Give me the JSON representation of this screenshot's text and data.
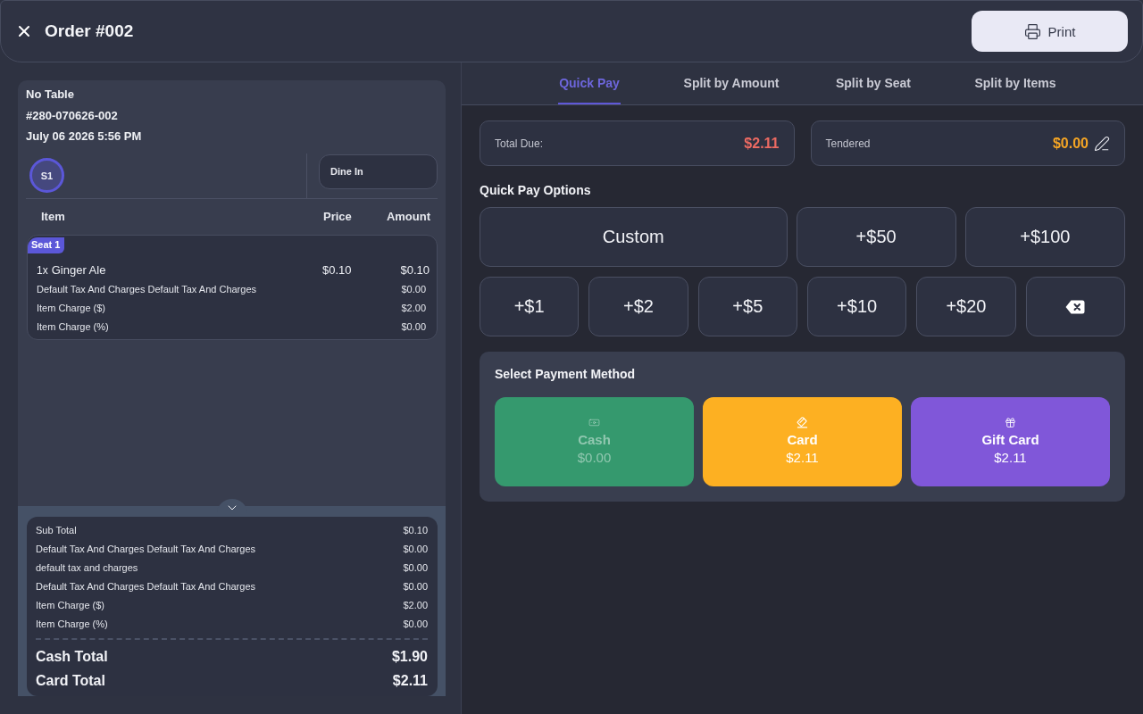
{
  "header": {
    "title": "Order #002",
    "print_label": "Print"
  },
  "order": {
    "table": "No Table",
    "number": "#280-070626-002",
    "datetime": "July 06 2026 5:56 PM",
    "seats": [
      {
        "label": "S1",
        "selected": true
      }
    ],
    "order_type": "Dine In",
    "columns": [
      "Item",
      "Price",
      "Amount"
    ],
    "seat_groups": [
      {
        "badge": "Seat 1",
        "items": [
          {
            "quantity": "1x",
            "name": "Ginger Ale",
            "price": "$0.10",
            "amount": "$0.10",
            "charges": [
              {
                "label": "Default Tax And Charges Default Tax And Charges",
                "amount": "$0.00"
              },
              {
                "label": "Item Charge ($)",
                "amount": "$2.00"
              },
              {
                "label": "Item Charge (%)",
                "amount": "$0.00"
              }
            ]
          }
        ]
      }
    ]
  },
  "summary": {
    "expanded": true,
    "rows": [
      {
        "label": "Sub Total",
        "amount": "$0.10"
      },
      {
        "label": "Default Tax And Charges Default Tax And Charges",
        "amount": "$0.00"
      },
      {
        "label": "default tax and charges",
        "amount": "$0.00"
      },
      {
        "label": "Default Tax And Charges Default Tax And Charges",
        "amount": "$0.00"
      },
      {
        "label": "Item Charge ($)",
        "amount": "$2.00"
      },
      {
        "label": "Item Charge (%)",
        "amount": "$0.00"
      }
    ],
    "totals": [
      {
        "label": "Cash Total",
        "amount": "$1.90"
      },
      {
        "label": "Card Total",
        "amount": "$2.11"
      }
    ]
  },
  "tabs": [
    {
      "label": "Quick Pay",
      "selected": true
    },
    {
      "label": "Split by Amount",
      "selected": false
    },
    {
      "label": "Split by Seat",
      "selected": false
    },
    {
      "label": "Split by Items",
      "selected": false
    }
  ],
  "due": {
    "label": "Total Due:",
    "amount": "$2.11"
  },
  "tendered": {
    "label": "Tendered",
    "amount": "$0.00"
  },
  "quick_pay": {
    "title": "Quick Pay Options",
    "presets": [
      {
        "kind": "custom",
        "label": "Custom"
      },
      {
        "kind": "amount",
        "label": "+$50"
      },
      {
        "kind": "amount",
        "label": "+$100"
      }
    ],
    "increments": [
      {
        "kind": "amount",
        "label": "+$1"
      },
      {
        "kind": "amount",
        "label": "+$2"
      },
      {
        "kind": "amount",
        "label": "+$5"
      },
      {
        "kind": "amount",
        "label": "+$10"
      },
      {
        "kind": "amount",
        "label": "+$20"
      },
      {
        "kind": "backspace"
      }
    ]
  },
  "payment": {
    "title": "Select Payment Method",
    "methods": [
      {
        "kind": "cash",
        "label": "Cash",
        "amount": "$0.00",
        "color": "#35996e",
        "disabled": true
      },
      {
        "kind": "card",
        "label": "Card",
        "amount": "$2.11",
        "color": "#fdb022",
        "disabled": false
      },
      {
        "kind": "gift_card",
        "label": "Gift Card",
        "amount": "$2.11",
        "color": "#8057d9",
        "disabled": false
      }
    ]
  }
}
